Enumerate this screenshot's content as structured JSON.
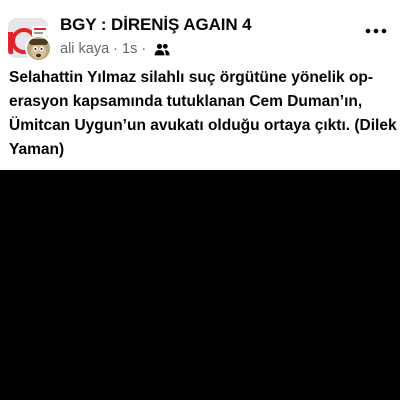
{
  "post": {
    "group_name": "BGY : DİRENİŞ AGAIN 4",
    "author": "ali kaya",
    "separator_1": "·",
    "time": "1s",
    "separator_2": "·",
    "audience_icon": "group-members-icon",
    "more_icon": "more-options-icon",
    "text_lines": [
      "Selahattin Yılmaz silahlı suç örgütüne yönelik op-",
      "erasyon kapsamında tutuklanan Cem Duman’ın,",
      "Ümitcan Uygun’un avukatı olduğu ortaya çıktı. (Dilek",
      "Yaman)"
    ]
  },
  "colors": {
    "card_background": "#ffffff",
    "page_background": "#000000",
    "primary_text": "#050505",
    "secondary_text": "#65676b",
    "group_avatar_accent": "#e0242b"
  }
}
